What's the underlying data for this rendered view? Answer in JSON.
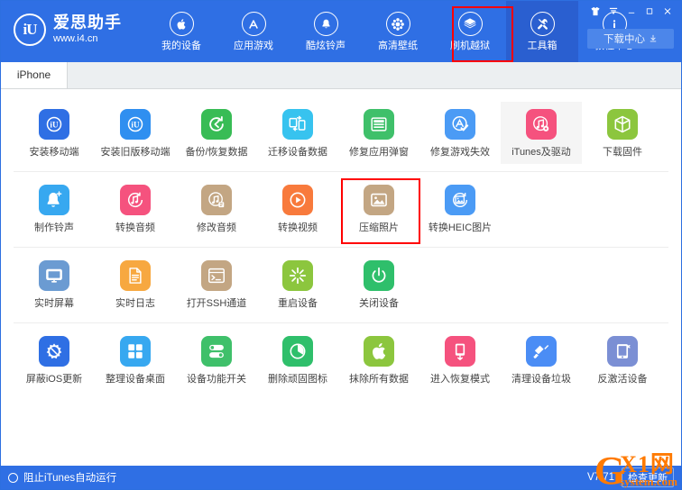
{
  "window": {
    "controls": [
      {
        "name": "skin-icon",
        "glyph": "T"
      },
      {
        "name": "menu-icon",
        "glyph": "▼"
      },
      {
        "name": "minimize-icon",
        "glyph": "–"
      },
      {
        "name": "maximize-icon",
        "glyph": "□"
      },
      {
        "name": "close-icon",
        "glyph": "✕"
      }
    ]
  },
  "brand": {
    "logo_text": "iU",
    "name": "爱思助手",
    "url": "www.i4.cn"
  },
  "nav": {
    "items": [
      {
        "label": "我的设备",
        "icon": "apple-icon",
        "active": false
      },
      {
        "label": "应用游戏",
        "icon": "appstore-icon",
        "active": false
      },
      {
        "label": "酷炫铃声",
        "icon": "bell-icon",
        "active": false
      },
      {
        "label": "高清壁纸",
        "icon": "flower-icon",
        "active": false
      },
      {
        "label": "刷机越狱",
        "icon": "box-arrow-icon",
        "active": false
      },
      {
        "label": "工具箱",
        "icon": "tools-icon",
        "active": true
      },
      {
        "label": "教程中心",
        "icon": "info-icon",
        "active": false
      }
    ],
    "download_center": "下载中心"
  },
  "tabs": [
    {
      "label": "iPhone",
      "active": true
    }
  ],
  "tools": {
    "rows": [
      [
        {
          "label": "安装移动端",
          "icon": "i4-app-icon",
          "bg": "#2f6fe4",
          "hovered": false
        },
        {
          "label": "安装旧版移动端",
          "icon": "i4-old-app-icon",
          "bg": "#2f8ff0",
          "hovered": false
        },
        {
          "label": "备份/恢复数据",
          "icon": "backup-restore-icon",
          "bg": "#38bc55",
          "hovered": false
        },
        {
          "label": "迁移设备数据",
          "icon": "device-transfer-icon",
          "bg": "#37c3ef",
          "hovered": false
        },
        {
          "label": "修复应用弹窗",
          "icon": "appleid-fix-icon",
          "bg": "#3fc06a",
          "hovered": false
        },
        {
          "label": "修复游戏失效",
          "icon": "appstore-fix-icon",
          "bg": "#4b9bf5",
          "hovered": false
        },
        {
          "label": "iTunes及驱动",
          "icon": "itunes-driver-icon",
          "bg": "#f5527e",
          "hovered": true
        },
        {
          "label": "下载固件",
          "icon": "firmware-icon",
          "bg": "#8cc63e",
          "hovered": false
        }
      ],
      [
        {
          "label": "制作铃声",
          "icon": "ringtone-make-icon",
          "bg": "#37a8f0",
          "hovered": false
        },
        {
          "label": "转换音频",
          "icon": "audio-convert-icon",
          "bg": "#f5527e",
          "hovered": false
        },
        {
          "label": "修改音频",
          "icon": "audio-edit-icon",
          "bg": "#c3a683",
          "hovered": false
        },
        {
          "label": "转换视频",
          "icon": "video-convert-icon",
          "bg": "#f87a3c",
          "hovered": false
        },
        {
          "label": "压缩照片",
          "icon": "photo-compress-icon",
          "bg": "#c3a683",
          "hovered": false
        },
        {
          "label": "转换HEIC图片",
          "icon": "heic-convert-icon",
          "bg": "#4b9bf5",
          "hovered": false
        }
      ],
      [
        {
          "label": "实时屏幕",
          "icon": "realtime-screen-icon",
          "bg": "#6b9bd2",
          "hovered": false
        },
        {
          "label": "实时日志",
          "icon": "realtime-log-icon",
          "bg": "#f7a840",
          "hovered": false
        },
        {
          "label": "打开SSH通道",
          "icon": "ssh-terminal-icon",
          "bg": "#c3a683",
          "hovered": false
        },
        {
          "label": "重启设备",
          "icon": "reboot-icon",
          "bg": "#8cc63e",
          "hovered": false
        },
        {
          "label": "关闭设备",
          "icon": "poweroff-icon",
          "bg": "#2fbf6b",
          "hovered": false
        }
      ],
      [
        {
          "label": "屏蔽iOS更新",
          "icon": "block-update-icon",
          "bg": "#2f6fe4",
          "hovered": false
        },
        {
          "label": "整理设备桌面",
          "icon": "desktop-organize-icon",
          "bg": "#37a8f0",
          "hovered": false
        },
        {
          "label": "设备功能开关",
          "icon": "feature-switch-icon",
          "bg": "#3fc06a",
          "hovered": false
        },
        {
          "label": "删除顽固图标",
          "icon": "delete-icon-icon",
          "bg": "#2fbf6b",
          "hovered": false
        },
        {
          "label": "抹除所有数据",
          "icon": "erase-all-icon",
          "bg": "#8cc63e",
          "hovered": false
        },
        {
          "label": "进入恢复模式",
          "icon": "recovery-mode-icon",
          "bg": "#f5527e",
          "hovered": false
        },
        {
          "label": "清理设备垃圾",
          "icon": "clean-junk-icon",
          "bg": "#4b8df5",
          "hovered": false
        },
        {
          "label": "反激活设备",
          "icon": "deactivate-icon",
          "bg": "#7b8fd4",
          "hovered": false
        }
      ]
    ]
  },
  "statusbar": {
    "block_itunes": "阻止iTunes自动运行",
    "version": "V7.71",
    "check_update": "检查更新"
  },
  "watermark": {
    "g": "G",
    "top": "X1网",
    "bottom": "system.com"
  },
  "colors": {
    "header_blue": "#2f6fe4",
    "active_blue": "#2a5fd0",
    "highlight_red": "#ff0000"
  }
}
